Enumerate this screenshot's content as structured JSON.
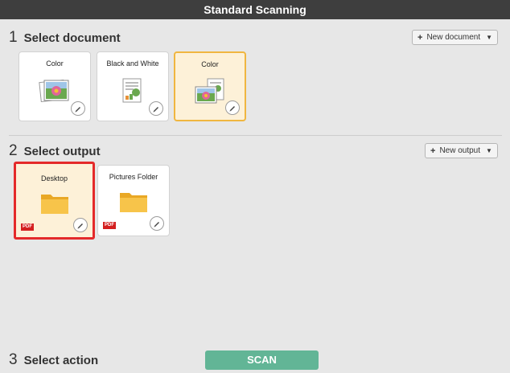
{
  "window": {
    "title": "Standard Scanning"
  },
  "sections": {
    "document": {
      "number": "1",
      "title": "Select document",
      "new_button": "New document"
    },
    "output": {
      "number": "2",
      "title": "Select output",
      "new_button": "New output"
    },
    "action": {
      "number": "3",
      "title": "Select action"
    }
  },
  "documents": [
    {
      "label": "Color",
      "icon": "color-photo-icon",
      "selected": false
    },
    {
      "label": "Black and White",
      "icon": "bw-document-icon",
      "selected": false
    },
    {
      "label": "Color",
      "icon": "color-mixed-icon",
      "selected": true
    }
  ],
  "outputs": [
    {
      "label": "Desktop",
      "icon": "folder-icon",
      "badge": "PDF",
      "selected": true
    },
    {
      "label": "Pictures Folder",
      "icon": "folder-icon",
      "badge": "PDF",
      "selected": false
    }
  ],
  "scan_button": "SCAN",
  "colors": {
    "titlebar": "#3e3e3e",
    "doc_selected_border": "#f0b640",
    "output_selected_border": "#e42a2a",
    "scan": "#62b596",
    "pdf_badge": "#d41f1f"
  }
}
